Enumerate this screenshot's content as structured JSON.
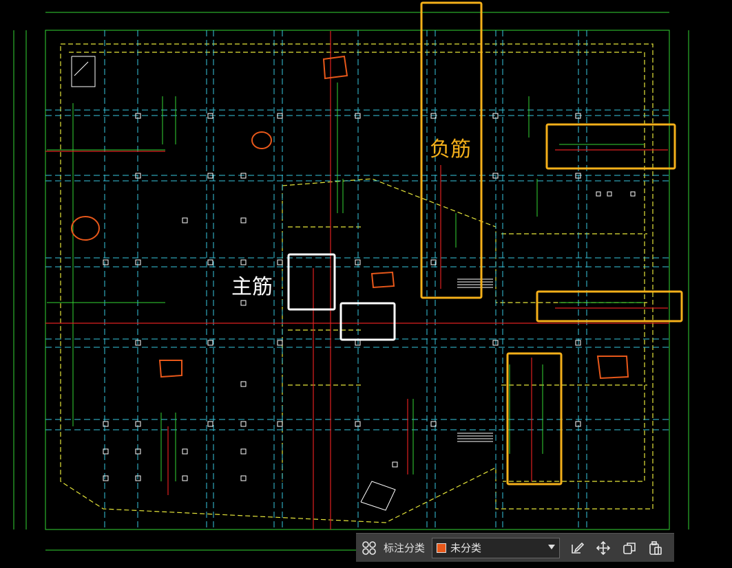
{
  "annotations": {
    "main_rebar_label": "主筋",
    "negative_rebar_label": "负筋"
  },
  "toolbar": {
    "category_label": "标注分类",
    "selected_category": "未分类",
    "swatch_color": "#e8581a",
    "icons": [
      "grid-icon",
      "edit-icon",
      "move-icon",
      "copy-icon",
      "paste-icon"
    ]
  },
  "colors": {
    "main_box": "#ffffff",
    "negative_box": "#f5b01a",
    "mark_circle": "#e8581a",
    "wall_line": "#e6e63a",
    "axis_line": "#38c8e0",
    "dimension_line": "#33d633",
    "rebar_line": "#e02020"
  }
}
